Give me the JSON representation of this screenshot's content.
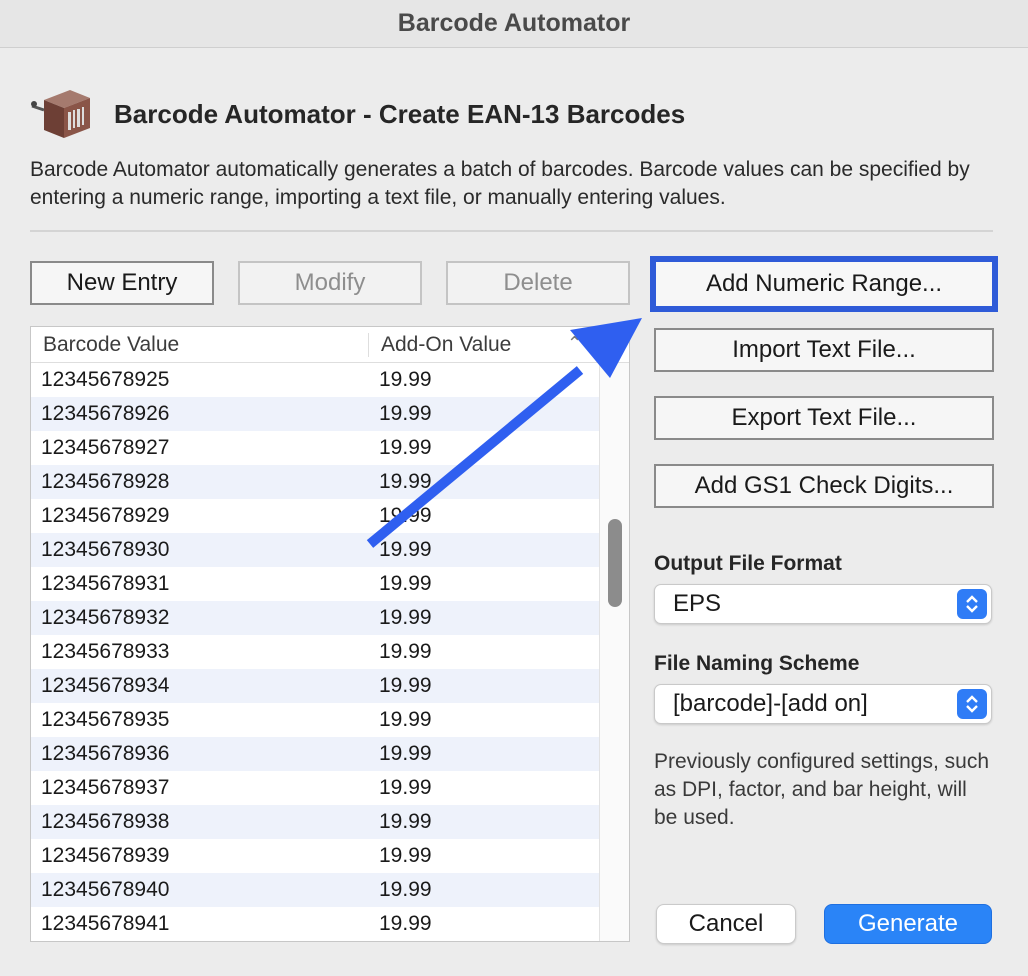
{
  "window": {
    "title": "Barcode Automator"
  },
  "header": {
    "title": "Barcode Automator - Create EAN-13 Barcodes",
    "description": "Barcode Automator automatically generates a batch of barcodes. Barcode values can be specified by entering a numeric range, importing a text file, or manually entering values."
  },
  "toolbar": {
    "new_entry": "New Entry",
    "modify": "Modify",
    "delete": "Delete"
  },
  "actions": {
    "add_numeric_range": "Add Numeric Range...",
    "import_text_file": "Import Text File...",
    "export_text_file": "Export Text File...",
    "add_gs1_check_digits": "Add GS1 Check Digits..."
  },
  "table": {
    "columns": [
      "Barcode Value",
      "Add-On Value"
    ],
    "rows": [
      [
        "12345678925",
        "19.99"
      ],
      [
        "12345678926",
        "19.99"
      ],
      [
        "12345678927",
        "19.99"
      ],
      [
        "12345678928",
        "19.99"
      ],
      [
        "12345678929",
        "19.99"
      ],
      [
        "12345678930",
        "19.99"
      ],
      [
        "12345678931",
        "19.99"
      ],
      [
        "12345678932",
        "19.99"
      ],
      [
        "12345678933",
        "19.99"
      ],
      [
        "12345678934",
        "19.99"
      ],
      [
        "12345678935",
        "19.99"
      ],
      [
        "12345678936",
        "19.99"
      ],
      [
        "12345678937",
        "19.99"
      ],
      [
        "12345678938",
        "19.99"
      ],
      [
        "12345678939",
        "19.99"
      ],
      [
        "12345678940",
        "19.99"
      ],
      [
        "12345678941",
        "19.99"
      ]
    ]
  },
  "output": {
    "format_label": "Output File Format",
    "format_value": "EPS",
    "naming_label": "File Naming Scheme",
    "naming_value": "[barcode]-[add on]",
    "note": "Previously configured settings, such as DPI, factor, and bar height, will be used."
  },
  "footer": {
    "cancel": "Cancel",
    "generate": "Generate"
  },
  "colors": {
    "highlight": "#2f5bd8",
    "annotation_arrow": "#2f5ff0",
    "primary_button": "#2a84f7"
  },
  "icons": {
    "app": "barcode-machine-icon",
    "sort": "chevron-up-icon",
    "select": "up-down-chevrons-icon"
  }
}
